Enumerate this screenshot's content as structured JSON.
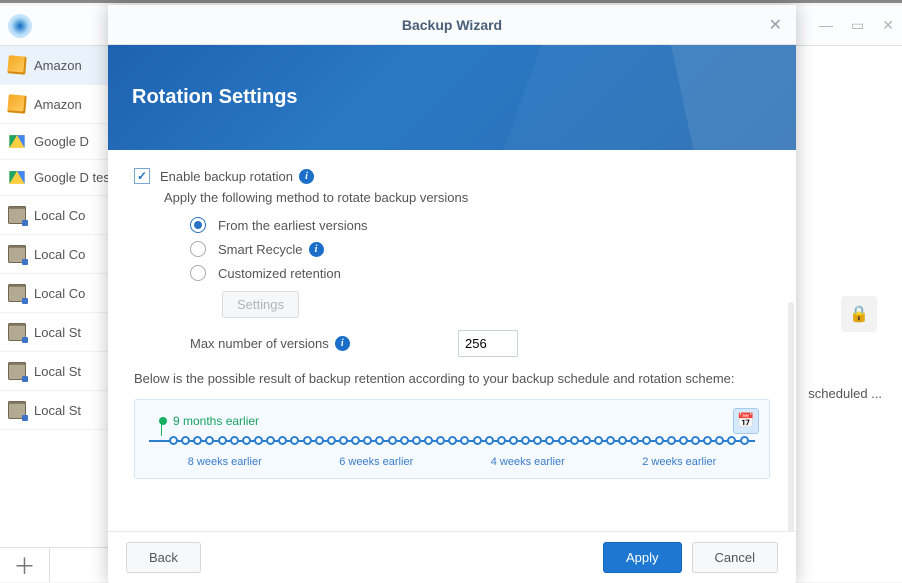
{
  "bg": {
    "sidebar_items": [
      {
        "icon": "amazon",
        "label": "Amazon",
        "selected": true
      },
      {
        "icon": "amazon",
        "label": "Amazon"
      },
      {
        "icon": "gdrive",
        "label": "Google D"
      },
      {
        "icon": "gdrive",
        "label": "Google D test"
      },
      {
        "icon": "local",
        "label": "Local Co"
      },
      {
        "icon": "local",
        "label": "Local Co"
      },
      {
        "icon": "local",
        "label": "Local Co"
      },
      {
        "icon": "local",
        "label": "Local St"
      },
      {
        "icon": "local",
        "label": "Local St"
      },
      {
        "icon": "local",
        "label": "Local St"
      }
    ],
    "right_text": "scheduled ..."
  },
  "modal": {
    "title": "Backup Wizard",
    "header": "Rotation Settings",
    "enable_label": "Enable backup rotation",
    "apply_method": "Apply the following method to rotate backup versions",
    "opt_earliest": "From the earliest versions",
    "opt_smart": "Smart Recycle",
    "opt_custom": "Customized retention",
    "settings_btn": "Settings",
    "max_label": "Max number of versions",
    "max_value": "256",
    "desc": "Below is the possible result of backup retention according to your backup schedule and rotation scheme:",
    "earliest": "9 months earlier",
    "tlabels": [
      "8 weeks earlier",
      "6 weeks earlier",
      "4 weeks earlier",
      "2 weeks earlier"
    ],
    "back": "Back",
    "apply": "Apply",
    "cancel": "Cancel"
  }
}
